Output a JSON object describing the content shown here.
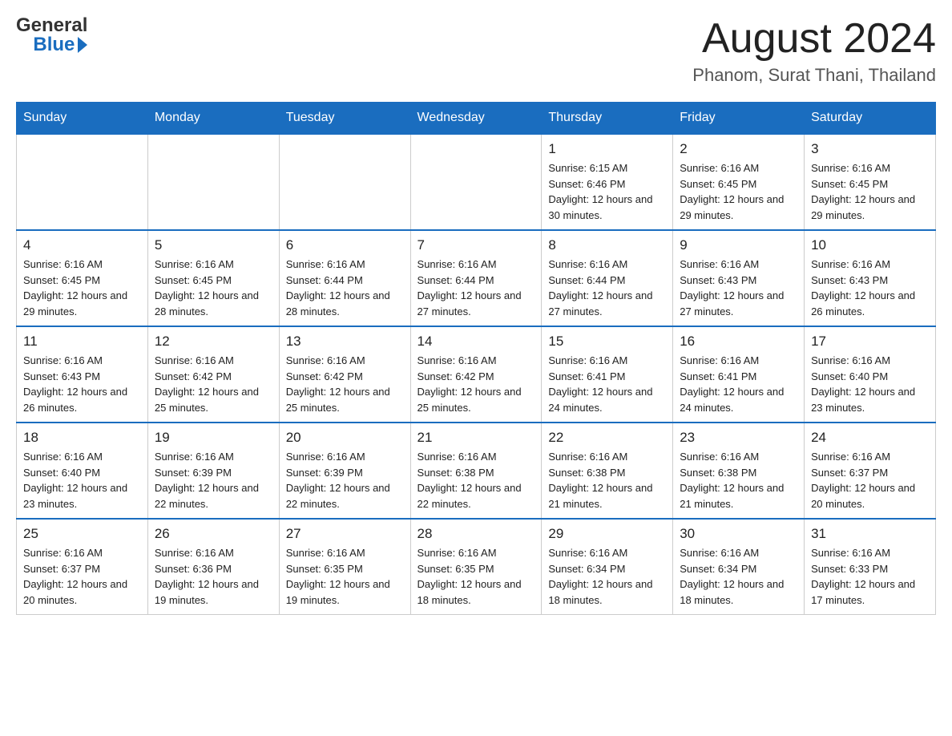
{
  "header": {
    "logo_general": "General",
    "logo_blue": "Blue",
    "month_title": "August 2024",
    "location": "Phanom, Surat Thani, Thailand"
  },
  "weekdays": [
    "Sunday",
    "Monday",
    "Tuesday",
    "Wednesday",
    "Thursday",
    "Friday",
    "Saturday"
  ],
  "weeks": [
    [
      {
        "day": "",
        "info": ""
      },
      {
        "day": "",
        "info": ""
      },
      {
        "day": "",
        "info": ""
      },
      {
        "day": "",
        "info": ""
      },
      {
        "day": "1",
        "info": "Sunrise: 6:15 AM\nSunset: 6:46 PM\nDaylight: 12 hours and 30 minutes."
      },
      {
        "day": "2",
        "info": "Sunrise: 6:16 AM\nSunset: 6:45 PM\nDaylight: 12 hours and 29 minutes."
      },
      {
        "day": "3",
        "info": "Sunrise: 6:16 AM\nSunset: 6:45 PM\nDaylight: 12 hours and 29 minutes."
      }
    ],
    [
      {
        "day": "4",
        "info": "Sunrise: 6:16 AM\nSunset: 6:45 PM\nDaylight: 12 hours and 29 minutes."
      },
      {
        "day": "5",
        "info": "Sunrise: 6:16 AM\nSunset: 6:45 PM\nDaylight: 12 hours and 28 minutes."
      },
      {
        "day": "6",
        "info": "Sunrise: 6:16 AM\nSunset: 6:44 PM\nDaylight: 12 hours and 28 minutes."
      },
      {
        "day": "7",
        "info": "Sunrise: 6:16 AM\nSunset: 6:44 PM\nDaylight: 12 hours and 27 minutes."
      },
      {
        "day": "8",
        "info": "Sunrise: 6:16 AM\nSunset: 6:44 PM\nDaylight: 12 hours and 27 minutes."
      },
      {
        "day": "9",
        "info": "Sunrise: 6:16 AM\nSunset: 6:43 PM\nDaylight: 12 hours and 27 minutes."
      },
      {
        "day": "10",
        "info": "Sunrise: 6:16 AM\nSunset: 6:43 PM\nDaylight: 12 hours and 26 minutes."
      }
    ],
    [
      {
        "day": "11",
        "info": "Sunrise: 6:16 AM\nSunset: 6:43 PM\nDaylight: 12 hours and 26 minutes."
      },
      {
        "day": "12",
        "info": "Sunrise: 6:16 AM\nSunset: 6:42 PM\nDaylight: 12 hours and 25 minutes."
      },
      {
        "day": "13",
        "info": "Sunrise: 6:16 AM\nSunset: 6:42 PM\nDaylight: 12 hours and 25 minutes."
      },
      {
        "day": "14",
        "info": "Sunrise: 6:16 AM\nSunset: 6:42 PM\nDaylight: 12 hours and 25 minutes."
      },
      {
        "day": "15",
        "info": "Sunrise: 6:16 AM\nSunset: 6:41 PM\nDaylight: 12 hours and 24 minutes."
      },
      {
        "day": "16",
        "info": "Sunrise: 6:16 AM\nSunset: 6:41 PM\nDaylight: 12 hours and 24 minutes."
      },
      {
        "day": "17",
        "info": "Sunrise: 6:16 AM\nSunset: 6:40 PM\nDaylight: 12 hours and 23 minutes."
      }
    ],
    [
      {
        "day": "18",
        "info": "Sunrise: 6:16 AM\nSunset: 6:40 PM\nDaylight: 12 hours and 23 minutes."
      },
      {
        "day": "19",
        "info": "Sunrise: 6:16 AM\nSunset: 6:39 PM\nDaylight: 12 hours and 22 minutes."
      },
      {
        "day": "20",
        "info": "Sunrise: 6:16 AM\nSunset: 6:39 PM\nDaylight: 12 hours and 22 minutes."
      },
      {
        "day": "21",
        "info": "Sunrise: 6:16 AM\nSunset: 6:38 PM\nDaylight: 12 hours and 22 minutes."
      },
      {
        "day": "22",
        "info": "Sunrise: 6:16 AM\nSunset: 6:38 PM\nDaylight: 12 hours and 21 minutes."
      },
      {
        "day": "23",
        "info": "Sunrise: 6:16 AM\nSunset: 6:38 PM\nDaylight: 12 hours and 21 minutes."
      },
      {
        "day": "24",
        "info": "Sunrise: 6:16 AM\nSunset: 6:37 PM\nDaylight: 12 hours and 20 minutes."
      }
    ],
    [
      {
        "day": "25",
        "info": "Sunrise: 6:16 AM\nSunset: 6:37 PM\nDaylight: 12 hours and 20 minutes."
      },
      {
        "day": "26",
        "info": "Sunrise: 6:16 AM\nSunset: 6:36 PM\nDaylight: 12 hours and 19 minutes."
      },
      {
        "day": "27",
        "info": "Sunrise: 6:16 AM\nSunset: 6:35 PM\nDaylight: 12 hours and 19 minutes."
      },
      {
        "day": "28",
        "info": "Sunrise: 6:16 AM\nSunset: 6:35 PM\nDaylight: 12 hours and 18 minutes."
      },
      {
        "day": "29",
        "info": "Sunrise: 6:16 AM\nSunset: 6:34 PM\nDaylight: 12 hours and 18 minutes."
      },
      {
        "day": "30",
        "info": "Sunrise: 6:16 AM\nSunset: 6:34 PM\nDaylight: 12 hours and 18 minutes."
      },
      {
        "day": "31",
        "info": "Sunrise: 6:16 AM\nSunset: 6:33 PM\nDaylight: 12 hours and 17 minutes."
      }
    ]
  ]
}
